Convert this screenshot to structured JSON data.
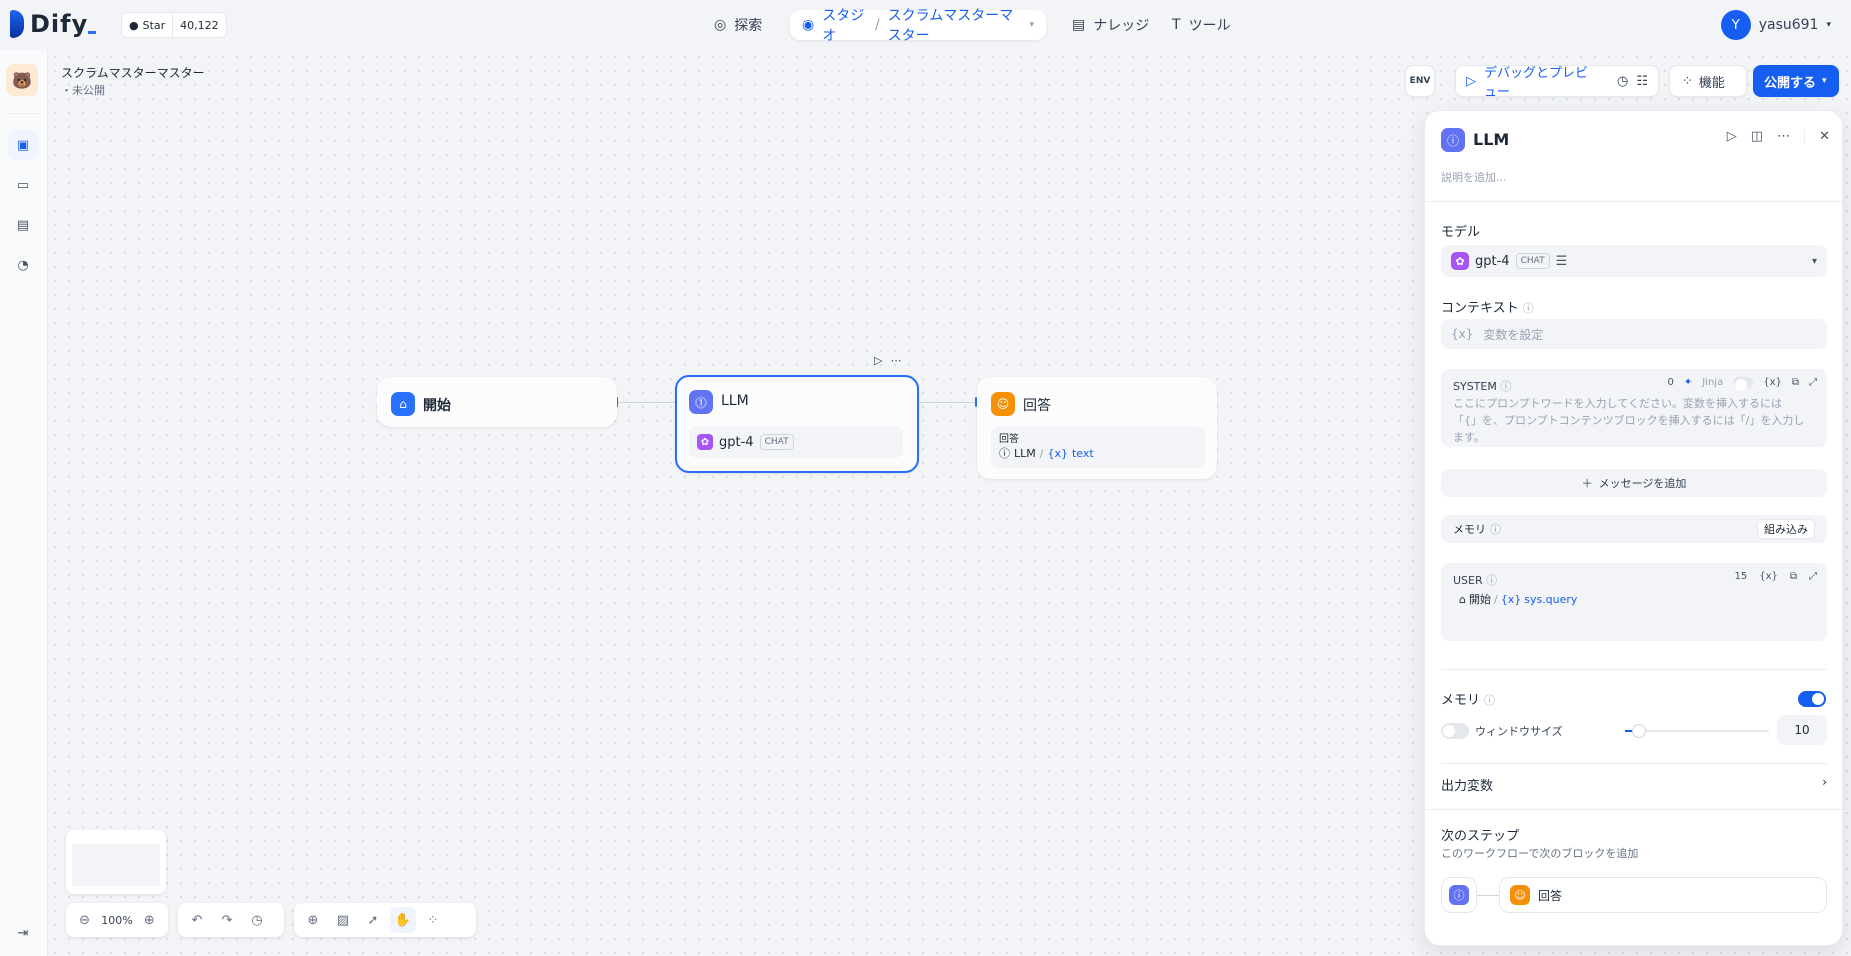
{
  "brand": {
    "name": "Dify"
  },
  "github": {
    "label": "Star",
    "count": "40,122"
  },
  "nav": {
    "explore": "探索",
    "studio": "スタジオ",
    "app_name": "スクラムマスターマスター",
    "knowledge": "ナレッジ",
    "tools": "ツール"
  },
  "user": {
    "initial": "Y",
    "name": "yasu691"
  },
  "app": {
    "title": "スクラムマスターマスター",
    "status": "・未公開"
  },
  "toolbar": {
    "env": "ENV",
    "debug": "デバッグとプレビュー",
    "features": "機能",
    "publish": "公開する"
  },
  "nodes": {
    "start": {
      "title": "開始"
    },
    "llm": {
      "title": "LLM",
      "model": "gpt-4",
      "mode": "CHAT"
    },
    "answer": {
      "title": "回答",
      "field": "回答",
      "src": "LLM",
      "var": "text"
    }
  },
  "zoom": "100%",
  "panel": {
    "title": "LLM",
    "desc_placeholder": "説明を追加...",
    "model_label": "モデル",
    "model": "gpt-4",
    "model_mode": "CHAT",
    "context_label": "コンテキスト",
    "context_placeholder": "変数を設定",
    "system": {
      "label": "SYSTEM",
      "count": "0",
      "jinja": "Jinja",
      "placeholder": "ここにプロンプトワードを入力してください。変数を挿入するには「{」を、プロンプトコンテンツブロックを挿入するには「/」を入力します。"
    },
    "add_message": "メッセージを追加",
    "memory_row": {
      "label": "メモリ",
      "value": "組み込み"
    },
    "user": {
      "label": "USER",
      "count": "15",
      "src": "開始",
      "var": "sys.query"
    },
    "memory": {
      "label": "メモリ",
      "enabled": true
    },
    "window": {
      "label": "ウィンドウサイズ",
      "value": "10",
      "enabled": false,
      "level": 0.1
    },
    "output_label": "出力変数",
    "next": {
      "label": "次のステップ",
      "desc": "このワークフローで次のブロックを追加",
      "target": "回答"
    }
  },
  "colors": {
    "accent": "#155eef",
    "start": "#2970ff",
    "llm": "#6172f3",
    "answer": "#f79009"
  }
}
